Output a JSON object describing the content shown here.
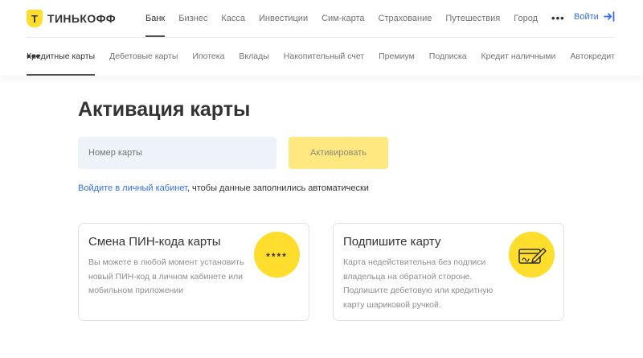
{
  "brand": {
    "logo_letter": "T",
    "name": "ТИНЬКОФФ",
    "accent": "#ffdd2d"
  },
  "top_nav": {
    "items": [
      {
        "label": "Банк",
        "active": true
      },
      {
        "label": "Бизнес"
      },
      {
        "label": "Касса"
      },
      {
        "label": "Инвестиции"
      },
      {
        "label": "Сим-карта"
      },
      {
        "label": "Страхование"
      },
      {
        "label": "Путешествия"
      },
      {
        "label": "Город"
      }
    ],
    "more": "•••",
    "login_label": "Войти"
  },
  "sub_nav": {
    "items": [
      {
        "label": "Кредитные карты",
        "active": true
      },
      {
        "label": "Дебетовые карты"
      },
      {
        "label": "Ипотека"
      },
      {
        "label": "Вклады"
      },
      {
        "label": "Накопительный счет"
      },
      {
        "label": "Премиум"
      },
      {
        "label": "Подписка"
      },
      {
        "label": "Кредит наличными"
      },
      {
        "label": "Автокредит"
      }
    ],
    "more": "•••"
  },
  "main": {
    "title": "Активация карты",
    "card_input": {
      "placeholder": "Номер карты",
      "value": ""
    },
    "activate_button": "Активировать",
    "hint_link": "Войдите в личный кабинет",
    "hint_rest": ", чтобы данные заполнились автоматически"
  },
  "cards": [
    {
      "title": "Смена ПИН-кода карты",
      "text": "Вы можете в любой момент установить новый ПИН-код в личном кабинете или мобильном приложении",
      "icon": "pin-stars-icon",
      "icon_text": "****"
    },
    {
      "title": "Подпишите карту",
      "text": "Карта недействительна без подписи владельца на обратной стороне. Подпишите дебетовую или кредитную карту шариковой ручкой.",
      "icon": "card-sign-icon"
    }
  ],
  "colors": {
    "link": "#336fee",
    "button_bg": "#ffe880",
    "input_bg": "#eef2f9"
  }
}
